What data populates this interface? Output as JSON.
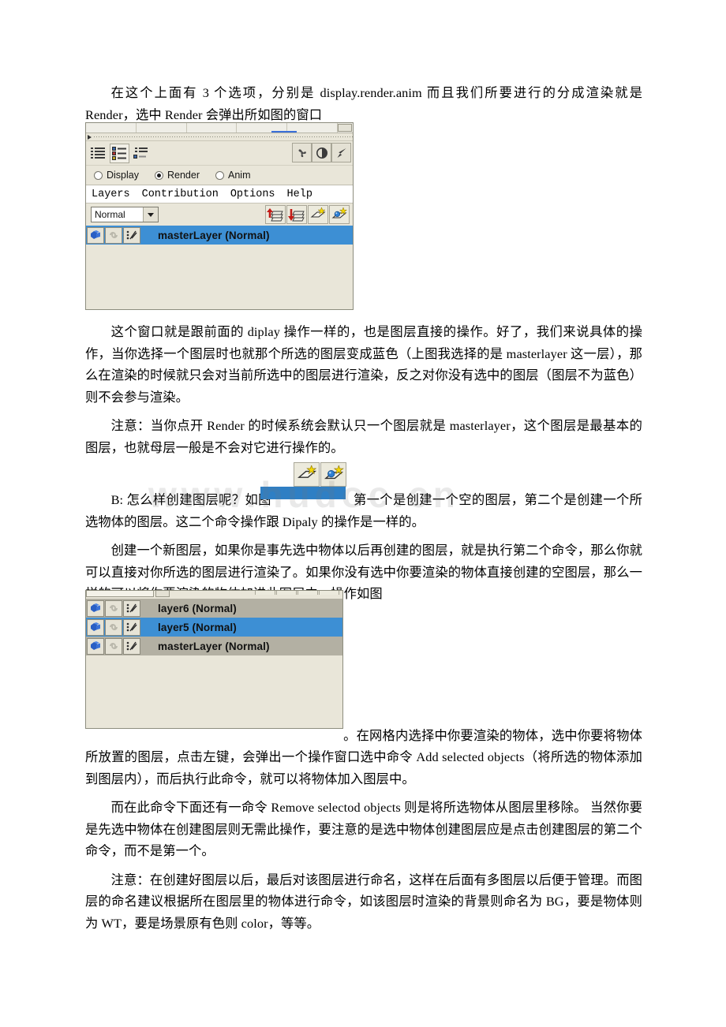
{
  "document": {
    "paragraphs": {
      "p1": "在这个上面有 3 个选项，分别是 display.render.anim 而且我们所要进行的分成渲染就是 Render，选中 Render 会弹出所如图的窗口",
      "p2": "这个窗口就是跟前面的 diplay 操作一样的，也是图层直接的操作。好了，我们来说具体的操作，当你选择一个图层时也就那个所选的图层变成蓝色（上图我选择的是 masterlayer 这一层），那么在渲染的时候就只会对当前所选中的图层进行渲染，反之对你没有选中的图层（图层不为蓝色）则不会参与渲染。",
      "p3": "注意：当你点开 Render 的时候系统会默认只一个图层就是 masterlayer，这个图层是最基本的图层，也就母层一般是不会对它进行操作的。",
      "p4_before_icon": "B: 怎么样创建图层呢？如图",
      "p4_after_icon": "第一个是创建一个空的图层，第二个是创建一个所选物体的图层。这二个命令操作跟 Dipaly 的操作是一样的。",
      "p5": "创建一个新图层，如果你是事先选中物体以后再创建的图层，就是执行第二个命令，那么你就可以直接对你所选的图层进行渲染了。如果你没有选中你要渲染的物体直接创建的空图层，那么一样的可以将你要渲染的物体加进此图层中，操作如图",
      "p6": "。在网格内选择中你要渲染的物体，选中你要将物体所放置的图层，点击左键，会弹出一个操作窗口选中命令 Add selected objects（将所选的物体添加到图层内），而后执行此命令，就可以将物体加入图层中。",
      "p7": "而在此命令下面还有一命令 Remove selectod objects 则是将所选物体从图层里移除。 当然你要是先选中物体在创建图层则无需此操作，要注意的是选中物体创建图层应是点击创建图层的第二个命令，而不是第一个。",
      "p8": "注意：在创建好图层以后，最后对该图层进行命名，这样在后面有多图层以后便于管理。而图层的命名建议根据所在图层里的物体进行命令，如该图层时渲染的背景则命名为 BG，要是物体则为 WT，要是场景原有色则 color，等等。"
    },
    "watermark": "www.hudoc.cn"
  },
  "layer_editor": {
    "view_buttons": [
      {
        "name": "list-view-icon",
        "state": "normal"
      },
      {
        "name": "detail-view-icon",
        "state": "pressed"
      },
      {
        "name": "compact-view-icon",
        "state": "normal"
      }
    ],
    "right_buttons": [
      {
        "name": "render-settings-icon"
      },
      {
        "name": "contrast-icon"
      },
      {
        "name": "arrow-pointer-icon"
      }
    ],
    "modes": [
      {
        "label": "Display",
        "selected": false
      },
      {
        "label": "Render",
        "selected": true
      },
      {
        "label": "Anim",
        "selected": false
      }
    ],
    "menu": [
      "Layers",
      "Contribution",
      "Options",
      "Help"
    ],
    "blend_mode": "Normal",
    "layer_ops": [
      {
        "name": "move-layer-up-icon"
      },
      {
        "name": "move-layer-down-icon"
      },
      {
        "name": "new-empty-layer-icon"
      },
      {
        "name": "new-layer-from-selection-icon"
      }
    ],
    "layers": [
      {
        "label": "masterLayer (Normal)",
        "selected": true
      }
    ]
  },
  "layer_list_panel": {
    "layers": [
      {
        "label": "layer6 (Normal)",
        "selected": false
      },
      {
        "label": "layer5 (Normal)",
        "selected": true
      },
      {
        "label": "masterLayer (Normal)",
        "selected": false
      }
    ]
  },
  "inline_icons": {
    "create_empty_layer": "new-empty-layer-icon",
    "create_layer_from_selection": "new-layer-from-selection-icon"
  },
  "colors": {
    "panel_bg": "#e9e6d9",
    "row_bg": "#b3b0a3",
    "selected_blue": "#3d8fd4",
    "inline_bar_blue": "#2f7fc4"
  }
}
